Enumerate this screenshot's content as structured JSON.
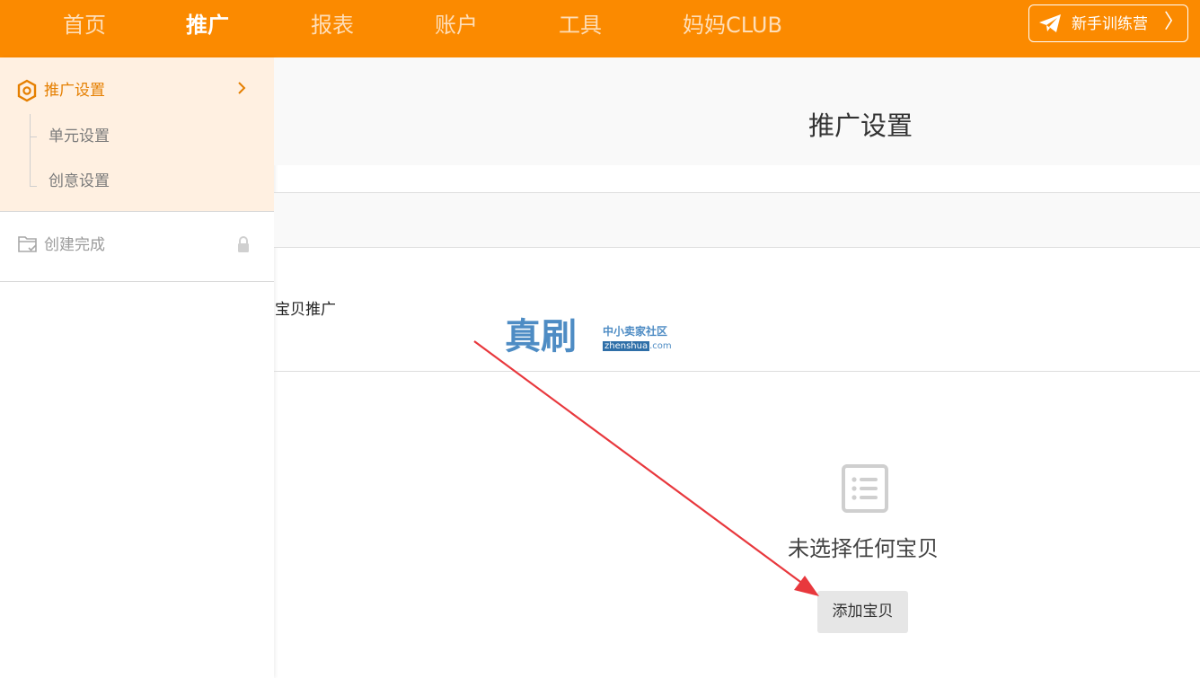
{
  "nav": {
    "items": [
      {
        "label": "首页"
      },
      {
        "label": "推广"
      },
      {
        "label": "报表"
      },
      {
        "label": "账户"
      },
      {
        "label": "工具"
      },
      {
        "label": "妈妈CLUB"
      }
    ],
    "active_index": 1,
    "trainer_button": "新手训练营",
    "trainer_chevron": "〉"
  },
  "sidebar": {
    "main_item": "推广设置",
    "sub_items": [
      "单元设置",
      "创意设置"
    ],
    "done_item": "创建完成"
  },
  "main": {
    "page_title": "推广设置",
    "promo_label": "宝贝推广",
    "empty_text": "未选择任何宝贝",
    "add_button": "添加宝贝"
  },
  "watermark": {
    "big": "真刷",
    "small": "中小卖家社区",
    "url_box": "zhenshua",
    "url_rest": ".com"
  },
  "colors": {
    "brand_orange": "#fb8a00",
    "sidebar_active_bg": "#fff0e1",
    "annotation_red": "#e8383d"
  }
}
